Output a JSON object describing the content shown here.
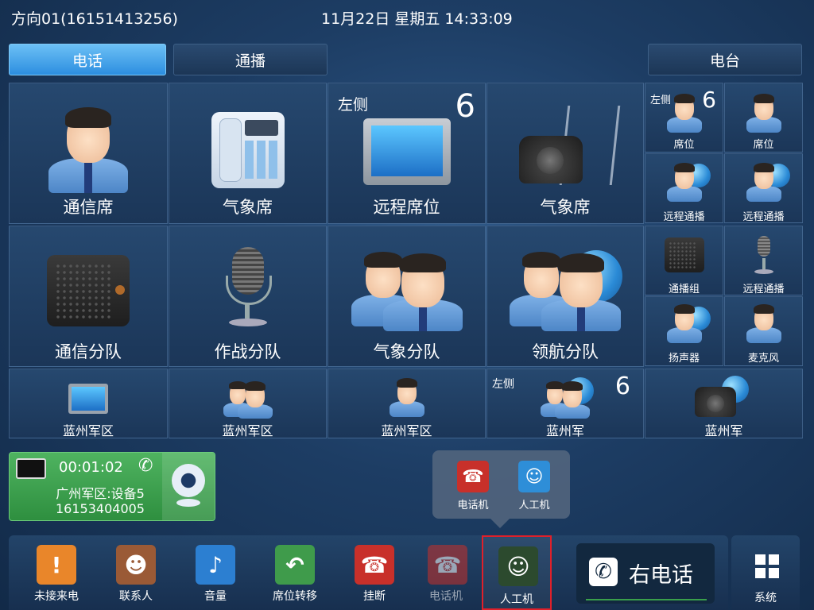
{
  "status": {
    "line": "方向01(16151413256)",
    "datetime": "11月22日 星期五 14:33:09"
  },
  "tabs": {
    "phone": "电话",
    "broadcast": "通播",
    "radio": "电台"
  },
  "tiles": {
    "t1": "通信席",
    "t2": "气象席",
    "t3": {
      "side": "左侧",
      "num": "6",
      "label": "远程席位"
    },
    "t4": "气象席",
    "s1": {
      "side": "左侧",
      "num": "6",
      "label": "席位"
    },
    "s2": "席位",
    "s3": "远程通播",
    "s4": "远程通播",
    "r1": "通信分队",
    "r2": "作战分队",
    "r3": "气象分队",
    "r4": "领航分队",
    "s5": "通播组",
    "s6": "远程通播",
    "s7": "扬声器",
    "s8": "麦克风",
    "b1": "蓝州军区",
    "b2": "蓝州军区",
    "b3": "蓝州军区",
    "b4": {
      "side": "左侧",
      "num": "6",
      "label": "蓝州军"
    },
    "b5": "蓝州军"
  },
  "call": {
    "timer": "00:01:02",
    "name": "广州军区:设备5",
    "number": "16153404005"
  },
  "popup": {
    "phone": "电话机",
    "operator": "人工机"
  },
  "dock": {
    "missed": "未接来电",
    "contacts": "联系人",
    "volume": "音量",
    "transfer": "席位转移",
    "hangup": "挂断",
    "phone": "电话机",
    "operator": "人工机",
    "right_phone": "右电话",
    "system": "系统"
  },
  "colors": {
    "active_tab": "#2c8ee0",
    "call_green": "#3aa04b",
    "hangup_red": "#c8302a",
    "selected_border": "#e0202a"
  }
}
